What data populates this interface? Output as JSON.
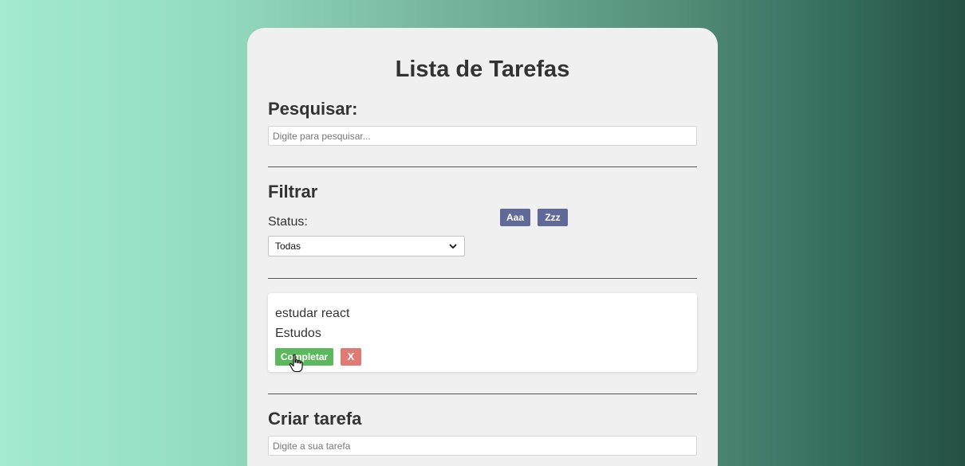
{
  "header": {
    "title": "Lista de Tarefas"
  },
  "search": {
    "heading": "Pesquisar:",
    "placeholder": "Digite para pesquisar...",
    "value": ""
  },
  "filter": {
    "heading": "Filtrar",
    "status_label": "Status:",
    "status_selected": "Todas",
    "sort_asc_label": "Aaa",
    "sort_desc_label": "Zzz"
  },
  "todos": [
    {
      "text": "estudar react",
      "category": "Estudos",
      "complete_label": "Completar",
      "remove_label": "X"
    }
  ],
  "create": {
    "heading": "Criar tarefa",
    "placeholder": "Digite a sua tarefa",
    "value": ""
  },
  "colors": {
    "background_gradient_start": "#a3ead0",
    "background_gradient_end": "#244f44",
    "card_bg": "#f0f0f0",
    "sort_button": "#5f6a98",
    "complete_button": "#5cb85c",
    "remove_button": "#e07b73"
  },
  "icons": {
    "select_arrow": "chevron-down-icon",
    "cursor": "hand-pointer-icon"
  }
}
